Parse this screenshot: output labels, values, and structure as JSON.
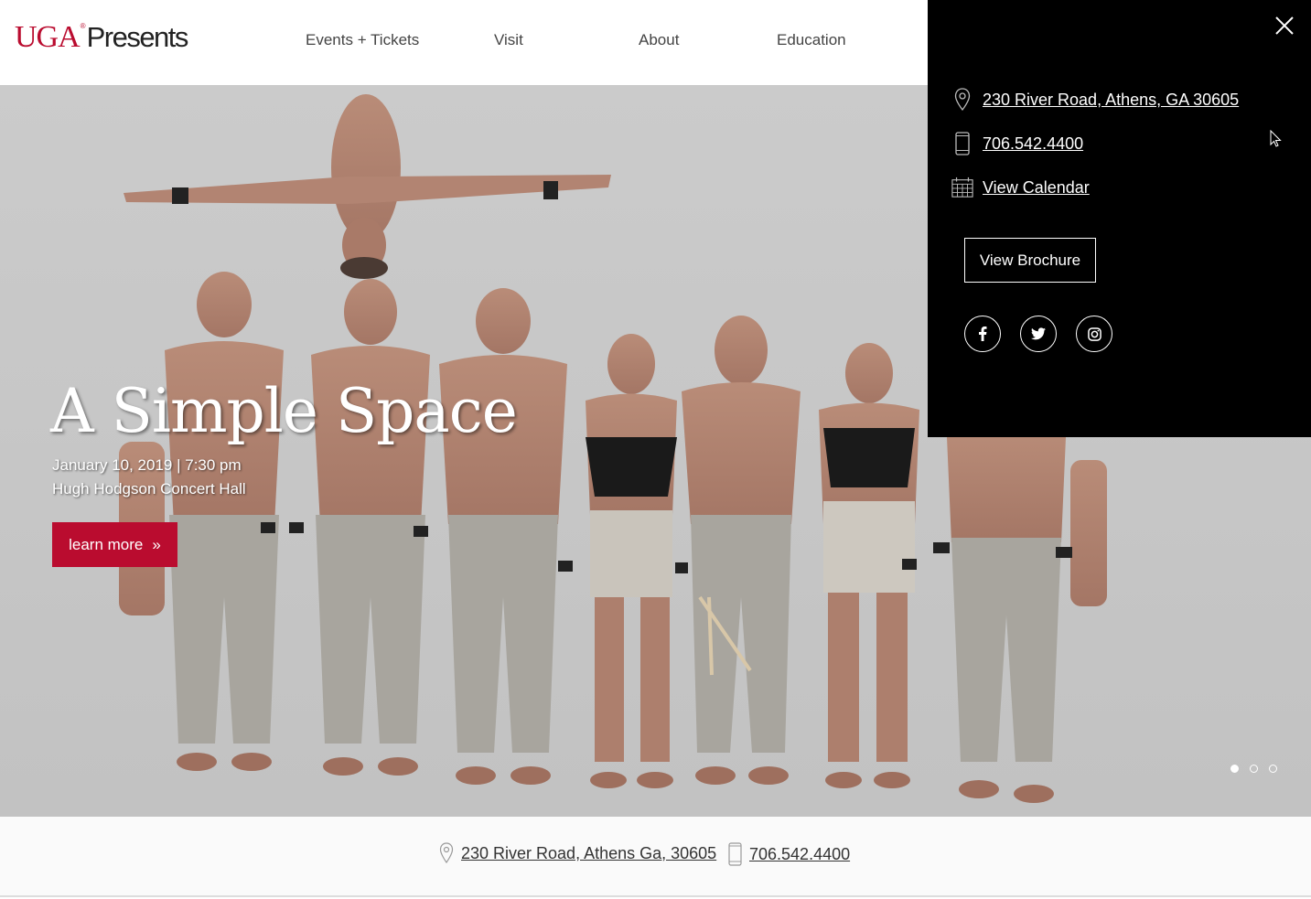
{
  "header": {
    "logo_uga": "UGA",
    "logo_reg": "®",
    "logo_presents": "Presents",
    "nav": [
      "Events + Tickets",
      "Visit",
      "About",
      "Education"
    ]
  },
  "hero": {
    "title": "A Simple Space",
    "date": "January 10, 2019 | 7:30 pm",
    "venue": "Hugh Hodgson Concert Hall",
    "cta_label": "learn more",
    "cta_arrow": "»",
    "slides": {
      "count": 3,
      "active": 1
    }
  },
  "panel": {
    "address": "230 River Road, Athens, GA 30605",
    "phone": "706.542.4400",
    "calendar": "View Calendar",
    "brochure": "View Brochure",
    "social": [
      "facebook-icon",
      "twitter-icon",
      "instagram-icon"
    ]
  },
  "footer": {
    "address": "230 River Road, Athens Ga, 30605",
    "phone": "706.542.4400"
  },
  "colors": {
    "brand_red": "#ba0c2f",
    "panel_bg": "#000000"
  }
}
